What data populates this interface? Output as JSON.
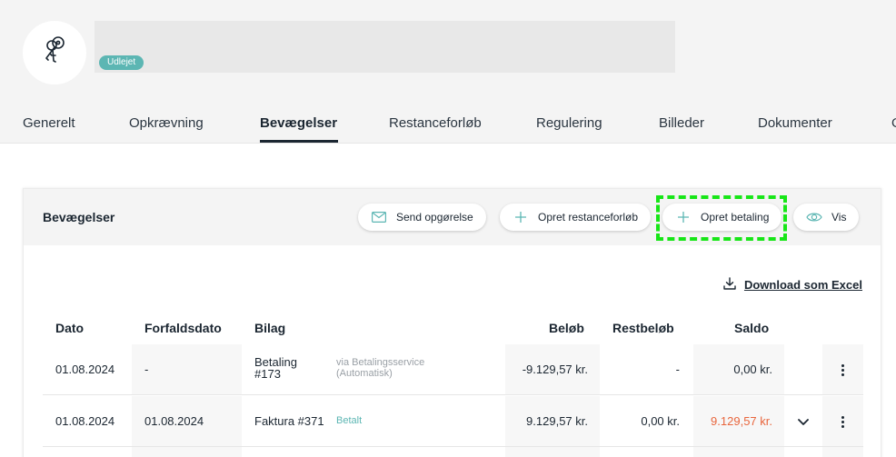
{
  "header": {
    "status_badge": "Udlejet",
    "avatar_icon": "keys-icon"
  },
  "tabs": [
    {
      "label": "Generelt"
    },
    {
      "label": "Opkrævning"
    },
    {
      "label": "Bevægelser",
      "active": true
    },
    {
      "label": "Restanceforløb"
    },
    {
      "label": "Regulering"
    },
    {
      "label": "Billeder"
    },
    {
      "label": "Dokumenter"
    },
    {
      "label": "O"
    }
  ],
  "card": {
    "title": "Bevægelser",
    "actions": {
      "send": "Send opgørelse",
      "restance": "Opret restanceforløb",
      "betaling": "Opret betaling",
      "vis": "Vis"
    },
    "download_label": "Download som Excel"
  },
  "table": {
    "columns": {
      "dato": "Dato",
      "forfaldsdato": "Forfaldsdato",
      "bilag": "Bilag",
      "beloeb": "Beløb",
      "restbeloeb": "Restbeløb",
      "saldo": "Saldo"
    },
    "rows": [
      {
        "dato": "01.08.2024",
        "forfaldsdato": "-",
        "bilag": "Betaling\n#173",
        "bilag_line1": "Betaling",
        "bilag_line2": "#173",
        "note_line1": "via Betalingsservice",
        "note_line2": "(Automatisk)",
        "beloeb": "-9.129,57 kr.",
        "restbeloeb": "-",
        "saldo": "0,00 kr."
      },
      {
        "dato": "01.08.2024",
        "forfaldsdato": "01.08.2024",
        "bilag": "Faktura #371",
        "status": "Betalt",
        "beloeb": "9.129,57 kr.",
        "restbeloeb": "0,00 kr.",
        "saldo": "9.129,57 kr."
      }
    ]
  },
  "colors": {
    "accent_teal": "#5cb6b3",
    "negative_saldo": "#e8663d",
    "highlight_box": "#17e617"
  }
}
